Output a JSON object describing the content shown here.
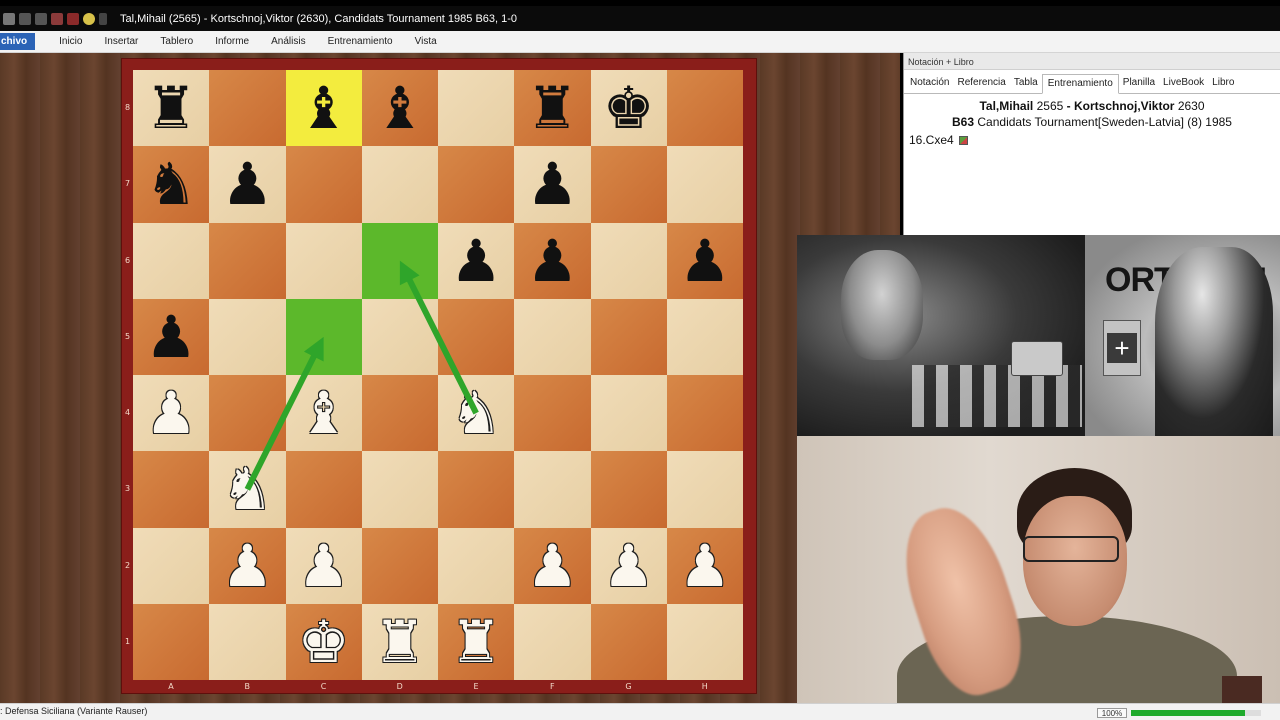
{
  "window": {
    "title": "Tal,Mihail (2565) - Kortschnoj,Viktor (2630), Candidats Tournament 1985  B63, 1-0"
  },
  "ribbon": {
    "file_label": "chivo",
    "tabs": [
      "Inicio",
      "Insertar",
      "Tablero",
      "Informe",
      "Análisis",
      "Entrenamiento",
      "Vista"
    ]
  },
  "board": {
    "ranks": [
      "8",
      "7",
      "6",
      "5",
      "4",
      "3",
      "2",
      "1"
    ],
    "files": [
      "A",
      "B",
      "C",
      "D",
      "E",
      "F",
      "G",
      "H"
    ],
    "position": [
      [
        "br",
        "",
        "bb",
        "bb",
        "",
        "br",
        "bk",
        ""
      ],
      [
        "bn",
        "bp",
        "",
        "",
        "",
        "bp",
        "",
        ""
      ],
      [
        "",
        "",
        "",
        "",
        "bp",
        "bp",
        "",
        "bp"
      ],
      [
        "bp",
        "",
        "",
        "",
        "",
        "",
        "",
        ""
      ],
      [
        "wp",
        "",
        "wb",
        "",
        "wn",
        "",
        "",
        ""
      ],
      [
        "",
        "wn",
        "",
        "",
        "",
        "",
        "",
        ""
      ],
      [
        "",
        "wp",
        "wp",
        "",
        "",
        "wp",
        "wp",
        "wp"
      ],
      [
        "",
        "",
        "wk",
        "wr",
        "wr",
        "",
        "",
        ""
      ]
    ],
    "highlight_yellow": "c8",
    "highlight_green": [
      "d6",
      "c5"
    ],
    "arrows": [
      [
        "e4",
        "d6"
      ],
      [
        "b3",
        "c5"
      ]
    ]
  },
  "panel": {
    "title": "Notación + Libro",
    "tabs": [
      "Notación",
      "Referencia",
      "Tabla",
      "Entrenamiento",
      "Planilla",
      "LiveBook",
      "Libro"
    ],
    "active_tab": "Entrenamiento",
    "white_player": "Tal,Mihail",
    "white_elo": "2565",
    "separator": "-",
    "black_player": "Kortschnoj,Viktor",
    "black_elo": "2630",
    "eco": "B63",
    "event": "Candidats Tournament[Sweden-Latvia] (8) 1985",
    "move": "16.Cxe4"
  },
  "photo": {
    "sign_text": "ORTSCHN",
    "flag_symbol": "+"
  },
  "status": {
    "opening": ": Defensa Siciliana (Variante Rauser)",
    "zoom": "100%",
    "progress": 0.88
  },
  "colors": {
    "ribbon_file_bg": "#2b63b6",
    "board_light": "#f0dcb8",
    "board_dark": "#c86a30",
    "frame": "#8a1e1a",
    "highlight_green": "#5cb82b",
    "highlight_yellow": "#f3ec3e",
    "arrow": "#2fa52a"
  }
}
